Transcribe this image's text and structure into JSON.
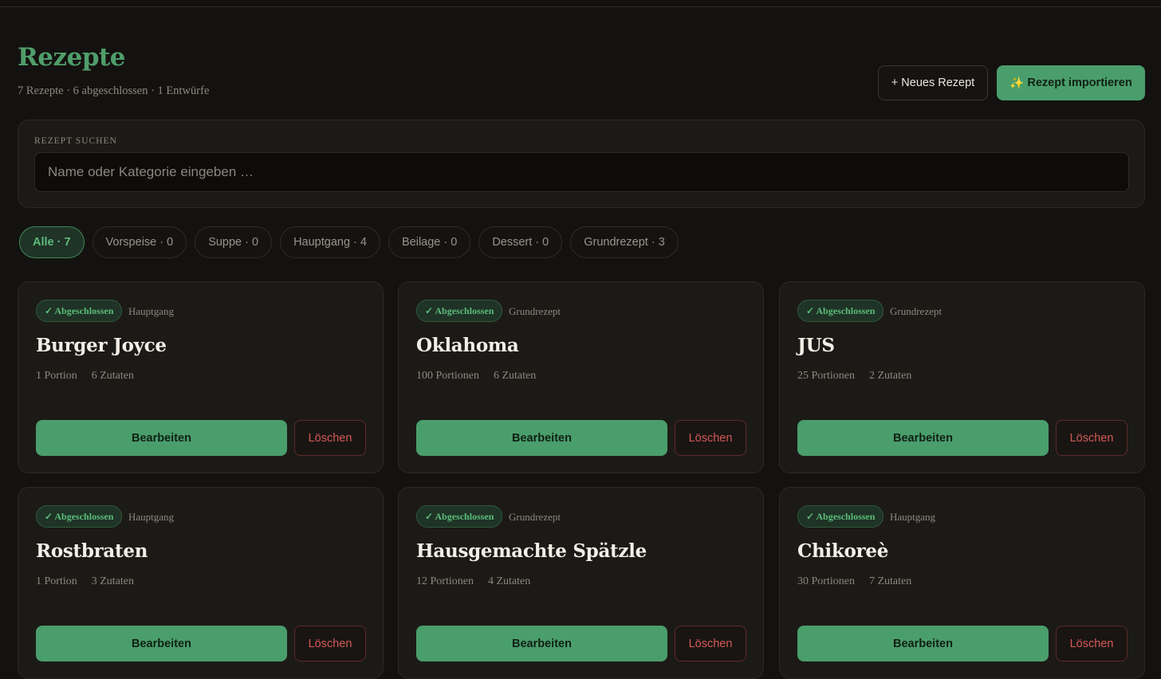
{
  "header": {
    "title": "Rezepte",
    "subtitle": "7 Rezepte · 6 abgeschlossen · 1 Entwürfe",
    "new_button": "+ Neues Rezept",
    "import_icon": "✨",
    "import_button": "Rezept importieren"
  },
  "search": {
    "label": "REZEPT SUCHEN",
    "placeholder": "Name oder Kategorie eingeben …",
    "value": ""
  },
  "filters": [
    {
      "label": "Alle · 7",
      "active": true
    },
    {
      "label": "Vorspeise · 0",
      "active": false
    },
    {
      "label": "Suppe · 0",
      "active": false
    },
    {
      "label": "Hauptgang · 4",
      "active": false
    },
    {
      "label": "Beilage · 0",
      "active": false
    },
    {
      "label": "Dessert · 0",
      "active": false
    },
    {
      "label": "Grundrezept · 3",
      "active": false
    }
  ],
  "card_labels": {
    "status": "✓ Abgeschlossen",
    "edit": "Bearbeiten",
    "delete": "Löschen"
  },
  "recipes": [
    {
      "title": "Burger Joyce",
      "category": "Hauptgang",
      "portions": "1 Portion",
      "ingredients": "6 Zutaten"
    },
    {
      "title": "Oklahoma",
      "category": "Grundrezept",
      "portions": "100 Portionen",
      "ingredients": "6 Zutaten"
    },
    {
      "title": "JUS",
      "category": "Grundrezept",
      "portions": "25 Portionen",
      "ingredients": "2 Zutaten"
    },
    {
      "title": "Rostbraten",
      "category": "Hauptgang",
      "portions": "1 Portion",
      "ingredients": "3 Zutaten"
    },
    {
      "title": "Hausgemachte Spätzle",
      "category": "Grundrezept",
      "portions": "12 Portionen",
      "ingredients": "4 Zutaten"
    },
    {
      "title": "Chikoreè",
      "category": "Hauptgang",
      "portions": "30 Portionen",
      "ingredients": "7 Zutaten"
    }
  ],
  "colors": {
    "accent": "#4a9e6b",
    "background": "#141210",
    "card": "#1c1a17",
    "danger": "#d35a55"
  }
}
